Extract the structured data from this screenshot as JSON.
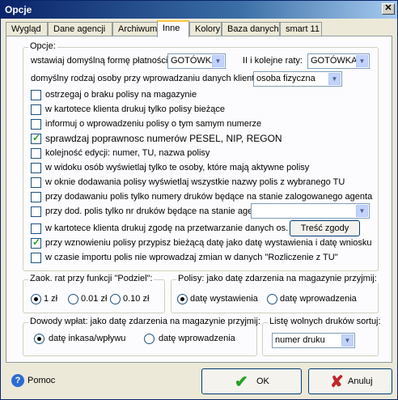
{
  "window": {
    "title": "Opcje"
  },
  "tabs": [
    "Wygląd",
    "Dane agencji",
    "Archiwum",
    "Inne",
    "Kolory",
    "Baza danych",
    "smart 11"
  ],
  "options": {
    "group_title": "Opcje:",
    "payment_label": "wstawiaj domyślną formę płatności :",
    "payment_value": "GOTÓWKA",
    "next_rates_label": "II i kolejne raty:",
    "next_rates_value": "GOTÓWKA",
    "person_type_label": "domyślny rodzaj osoby przy wprowadzaniu danych klienta:",
    "person_type_value": "osoba fizyczna",
    "checkboxes": [
      {
        "label": "ostrzegaj o braku polisy na magazynie",
        "checked": false
      },
      {
        "label": "w kartotece klienta drukuj tylko polisy bieżące",
        "checked": false
      },
      {
        "label": "informuj o wprowadzeniu polisy o tym samym numerze",
        "checked": false
      },
      {
        "label": "sprawdzaj poprawnosc numerów PESEL, NIP, REGON",
        "checked": true
      },
      {
        "label": "kolejność edycji: numer, TU, nazwa polisy",
        "checked": false
      },
      {
        "label": "w widoku osób wyświetlaj tylko te osoby, które mają aktywne polisy",
        "checked": false
      },
      {
        "label": "w oknie dodawania polisy wyświetlaj wszystkie nazwy polis z wybranego TU",
        "checked": false
      },
      {
        "label": "przy dodawaniu polis tylko numery druków będące na stanie zalogowanego agenta",
        "checked": false
      },
      {
        "label": "przy dod. polis tylko nr druków będące na stanie agenta:",
        "checked": false
      },
      {
        "label": "w kartotece klienta drukuj zgodę na przetwarzanie danych os.",
        "checked": false
      },
      {
        "label": "przy wznowieniu polisy przypisz bieżącą datę jako datę wystawienia i datę wniosku",
        "checked": true
      },
      {
        "label": "w czasie importu polis nie wprowadzaj zmian w danych \"Rozliczenie z TU\"",
        "checked": false
      }
    ],
    "agent_select_value": "",
    "consent_button": "Treść zgody"
  },
  "rounding": {
    "title": "Zaok. rat przy funkcji \"Podziel\":",
    "options": [
      "1 zł",
      "0.01 zł",
      "0.10 zł"
    ],
    "selected": 0
  },
  "policies": {
    "title": "Polisy: jako datę zdarzenia na magazynie przyjmij:",
    "options": [
      "datę wystawienia",
      "datę wprowadzenia"
    ],
    "selected": 0
  },
  "payments": {
    "title": "Dowody wpłat: jako datę zdarzenia na magazynie przyjmij:",
    "options": [
      "datę inkasa/wpływu",
      "datę wprowadzenia"
    ],
    "selected": 0
  },
  "free_forms": {
    "title": "Listę wolnych druków sortuj:",
    "value": "numer druku"
  },
  "footer": {
    "help": "Pomoc",
    "ok": "OK",
    "cancel": "Anuluj"
  },
  "colors": {
    "accent": "#0a246a",
    "ok_check": "#21a121",
    "cancel_x": "#c0272d"
  }
}
